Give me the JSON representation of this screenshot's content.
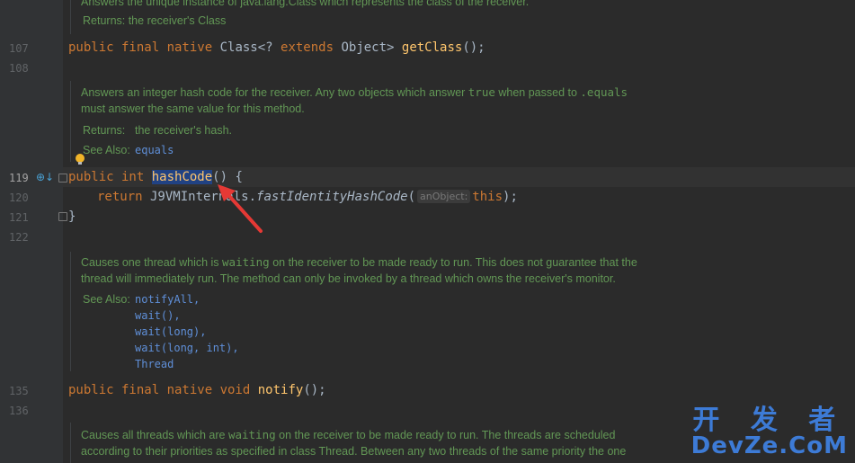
{
  "lines": [
    {
      "num": "107"
    },
    {
      "num": "108"
    },
    {
      "num": "119"
    },
    {
      "num": "120"
    },
    {
      "num": "121"
    },
    {
      "num": "122"
    },
    {
      "num": "135"
    },
    {
      "num": "136"
    }
  ],
  "doc0": {
    "text_partial": "Answers the unique instance of java.lang.Class which represents the class of the receiver.",
    "returns": "Returns: the receiver's Class"
  },
  "getClass_line": {
    "kw": "public final native",
    "rest_type": " Class<? ",
    "extends": "extends",
    "obj": " Object> ",
    "method": "getClass",
    "end": "();"
  },
  "doc1": {
    "line1_pre": "Answers an integer hash code for the receiver. Any two objects which answer ",
    "line1_code1": "true",
    "line1_mid": " when passed to ",
    "line1_code2": ".equals",
    "line2": "must answer the same value for this method.",
    "returns_label": "Returns:",
    "returns_value": "the receiver's hash.",
    "see_label": "See Also:",
    "see_link": "equals"
  },
  "hashCode_line": {
    "kw": "public int",
    "method": "hashCode",
    "end": "() {"
  },
  "return_line": {
    "kw": "return",
    "cls": " J9VMInternals",
    "method": "fastIdentityHashCode",
    "open": "(",
    "hint": "anObject:",
    "arg": "this",
    "close": ");"
  },
  "close_line": {
    "text": "}"
  },
  "doc2": {
    "line1_pre": "Causes one thread which is ",
    "line1_code": "waiting",
    "line1_post": " on the receiver to be made ready to run. This does not guarantee that the",
    "line2": "thread will immediately run. The method can only be invoked by a thread which owns the receiver's monitor.",
    "see_label": "See Also:",
    "links": [
      "notifyAll,",
      "wait(),",
      "wait(long),",
      "wait(long, int),",
      "Thread"
    ]
  },
  "notify_line": {
    "kw": "public final native void",
    "method": "notify",
    "end": "();"
  },
  "doc3": {
    "line1_pre": "Causes all threads which are ",
    "line1_code": "waiting",
    "line1_post": " on the receiver to be made ready to run. The threads are scheduled",
    "line2": "according to their priorities as specified in class Thread. Between any two threads of the same priority the one"
  },
  "watermark": {
    "line1": "开 发 者",
    "line2": "DevZe.CoM"
  },
  "colors": {
    "arrow": "#e53935",
    "selection": "#214283"
  },
  "icons": {
    "bulb": "lightbulb-icon",
    "override": "override-icon"
  }
}
